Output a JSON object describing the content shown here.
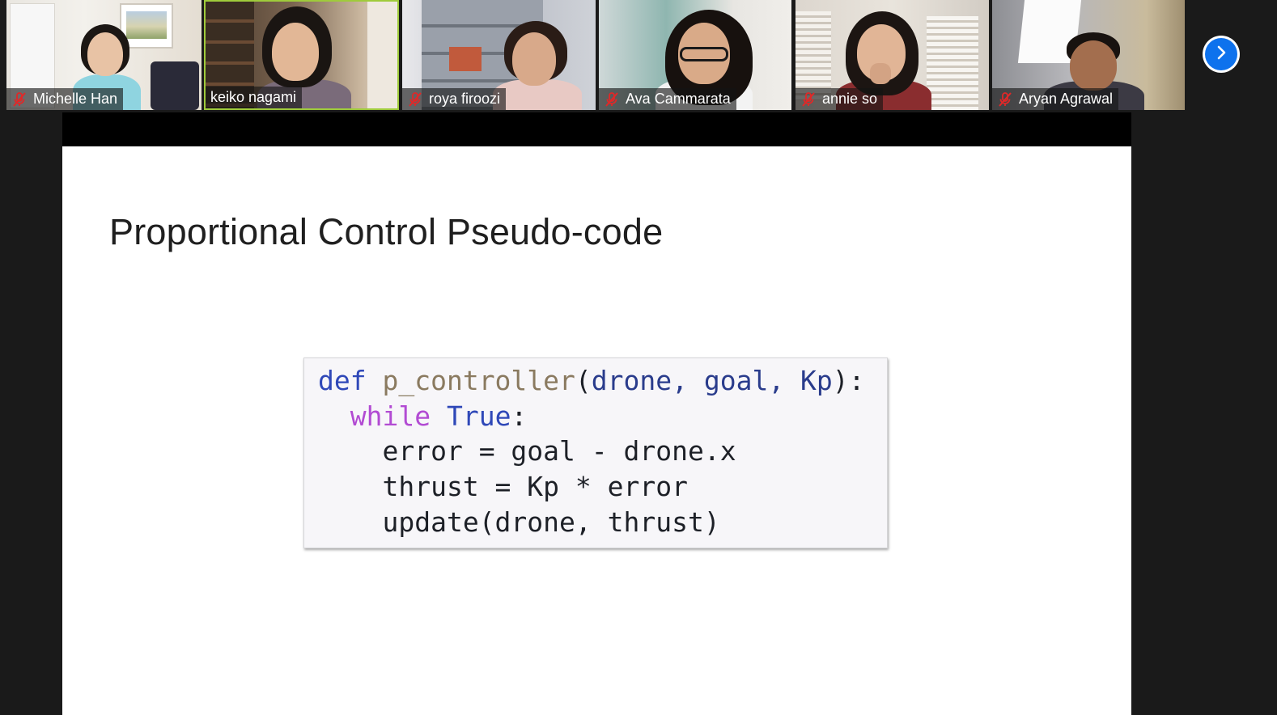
{
  "participants": [
    {
      "name": "Michelle Han",
      "muted": true
    },
    {
      "name": "keiko nagami",
      "muted": false,
      "active_speaker": true
    },
    {
      "name": "roya firoozi",
      "muted": true
    },
    {
      "name": "Ava Cammarata",
      "muted": true
    },
    {
      "name": "annie so",
      "muted": true
    },
    {
      "name": "Aryan Agrawal",
      "muted": true
    }
  ],
  "gallery": {
    "next_page_icon": "chevron-right-icon",
    "accent_color": "#0e72ed",
    "speaker_highlight_color": "#9fcb3b",
    "muted_icon_color": "#e02828"
  },
  "slide": {
    "title": "Proportional Control Pseudo-code",
    "code": {
      "line1": {
        "kw": "def",
        "name": "p_controller",
        "open": "(",
        "args": "drone, goal, Kp",
        "close": "):"
      },
      "line2": {
        "kw": "while",
        "value": "True",
        "colon": ":"
      },
      "line3": "error = goal - drone.x",
      "line4": "thrust = Kp * error",
      "line5": "update(drone, thrust)"
    }
  }
}
